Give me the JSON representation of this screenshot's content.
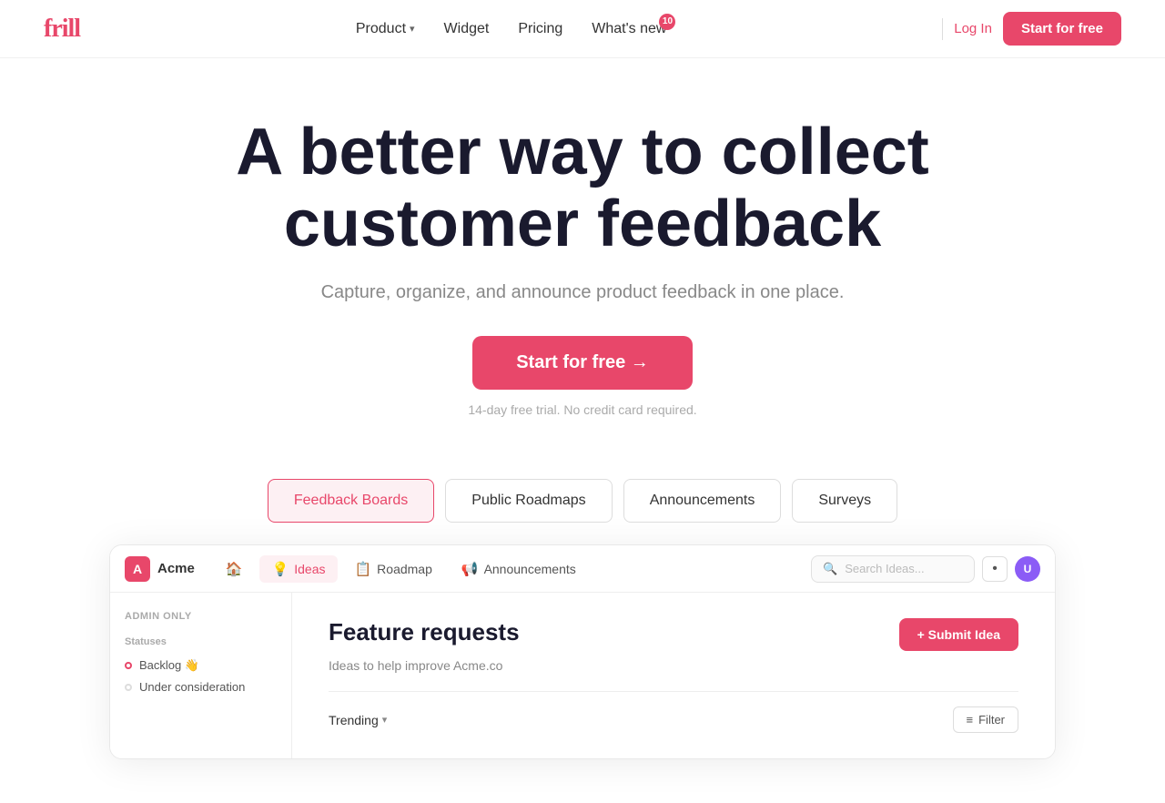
{
  "navbar": {
    "logo": "frill",
    "links": [
      {
        "label": "Product",
        "has_dropdown": true
      },
      {
        "label": "Widget",
        "has_dropdown": false
      },
      {
        "label": "Pricing",
        "has_dropdown": false
      },
      {
        "label": "What's new",
        "badge": "10",
        "has_dropdown": false
      }
    ],
    "login_label": "Log In",
    "start_label": "Start for free"
  },
  "hero": {
    "title_line1": "A better way to collect",
    "title_line2": "customer feedback",
    "subtitle": "Capture, organize, and announce product feedback in one place.",
    "cta_label": "Start for free →",
    "trial_note": "14-day free trial. No credit card required."
  },
  "tabs": [
    {
      "label": "Feedback Boards",
      "active": true
    },
    {
      "label": "Public Roadmaps",
      "active": false
    },
    {
      "label": "Announcements",
      "active": false
    },
    {
      "label": "Surveys",
      "active": false
    }
  ],
  "app_preview": {
    "navbar": {
      "org_logo": "A",
      "org_name": "Acme",
      "nav_items": [
        {
          "icon": "🏠",
          "label": "Home",
          "active": false
        },
        {
          "icon": "💡",
          "label": "Ideas",
          "active": true
        },
        {
          "icon": "📋",
          "label": "Roadmap",
          "active": false
        },
        {
          "icon": "📢",
          "label": "Announcements",
          "active": false
        }
      ],
      "search_placeholder": "Search Ideas...",
      "dot_icon": "•",
      "avatar_initial": "U"
    },
    "sidebar": {
      "admin_label": "Admin only",
      "statuses_label": "Statuses",
      "items": [
        {
          "label": "Backlog 👋",
          "dot_color": "pink"
        },
        {
          "label": "Under consideration",
          "dot_color": ""
        }
      ]
    },
    "main": {
      "board_title": "Feature requests",
      "board_desc": "Ideas to help improve Acme.co",
      "submit_label": "+ Submit Idea",
      "trending_label": "Trending",
      "filter_label": "Filter"
    }
  },
  "colors": {
    "primary": "#e8476a",
    "text_dark": "#1a1a2e",
    "text_muted": "#888"
  }
}
